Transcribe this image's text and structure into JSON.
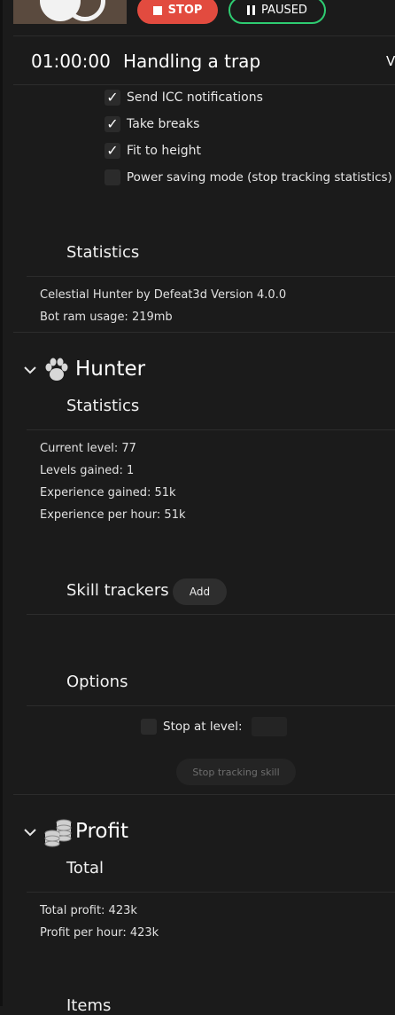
{
  "toolbar": {
    "stop_label": "STOP",
    "paused_label": "PAUSED"
  },
  "status": {
    "timer": "01:00:00",
    "activity": "Handling a trap",
    "right_clip": "V"
  },
  "settings": {
    "items": [
      {
        "label": "Send ICC notifications",
        "checked": true
      },
      {
        "label": "Take breaks",
        "checked": true
      },
      {
        "label": "Fit to height",
        "checked": true
      },
      {
        "label": "Power saving mode (stop tracking statistics)",
        "checked": false
      }
    ],
    "check_glyph": "✓"
  },
  "general": {
    "heading": "Statistics",
    "lines": [
      "Celestial Hunter by Defeat3d Version 4.0.0",
      "Bot ram usage: 219mb"
    ]
  },
  "hunter": {
    "title": "Hunter",
    "stats_heading": "Statistics",
    "stats": [
      "Current level: 77",
      "Levels gained: 1",
      "Experience gained: 51k",
      "Experience per hour: 51k"
    ],
    "skill_trackers_heading": "Skill trackers",
    "add_label": "Add",
    "options_heading": "Options",
    "stop_at_level_label": "Stop at level:",
    "stop_tracking_label": "Stop tracking skill"
  },
  "profit": {
    "title": "Profit",
    "total_heading": "Total",
    "lines": [
      "Total profit: 423k",
      "Profit per hour: 423k"
    ],
    "next_heading_clip": "Items"
  },
  "icons": {
    "chevron": "⌄"
  },
  "colors": {
    "background": "#1b1b1b",
    "stop_red": "#e24b3f",
    "paused_green": "#2ecc71"
  }
}
